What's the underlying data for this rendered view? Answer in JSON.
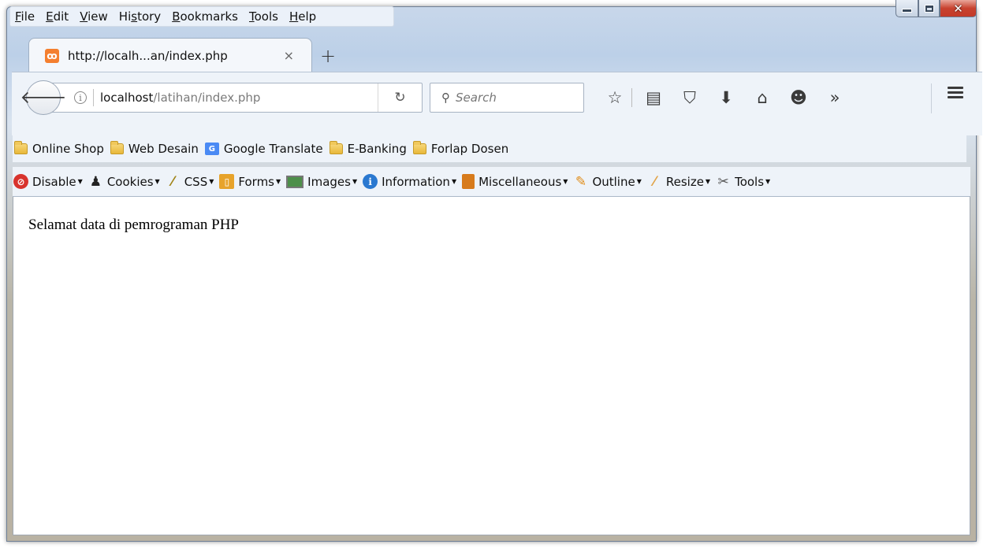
{
  "menubar": {
    "items": [
      {
        "label": "File",
        "acc": "F",
        "rest": "ile"
      },
      {
        "label": "Edit",
        "acc": "E",
        "rest": "dit"
      },
      {
        "label": "View",
        "acc": "V",
        "rest": "iew"
      },
      {
        "label": "History",
        "pre": "Hi",
        "acc": "s",
        "rest": "tory"
      },
      {
        "label": "Bookmarks",
        "acc": "B",
        "rest": "ookmarks"
      },
      {
        "label": "Tools",
        "acc": "T",
        "rest": "ools"
      },
      {
        "label": "Help",
        "acc": "H",
        "rest": "elp"
      }
    ]
  },
  "tab": {
    "title": "http://localh...an/index.php",
    "favicon": "xampp-icon",
    "close": "×"
  },
  "newtab": "+",
  "urlbar": {
    "host": "localhost",
    "path": "/latihan/index.php"
  },
  "search": {
    "placeholder": "Search"
  },
  "toolbar_icons": [
    "star-icon",
    "reading-list-icon",
    "pocket-icon",
    "download-icon",
    "home-icon",
    "hello-icon",
    "overflow-icon",
    "menu-icon"
  ],
  "bookmarks": [
    {
      "label": "Online Shop",
      "icon": "folder-icon"
    },
    {
      "label": "Web Desain",
      "icon": "folder-icon"
    },
    {
      "label": "Google Translate",
      "icon": "google-translate-icon"
    },
    {
      "label": "E-Banking",
      "icon": "folder-icon"
    },
    {
      "label": "Forlap Dosen",
      "icon": "folder-icon"
    }
  ],
  "devbar": [
    {
      "label": "Disable",
      "icon": "disable-icon"
    },
    {
      "label": "Cookies",
      "icon": "cookies-icon"
    },
    {
      "label": "CSS",
      "icon": "css-icon"
    },
    {
      "label": "Forms",
      "icon": "forms-icon"
    },
    {
      "label": "Images",
      "icon": "images-icon"
    },
    {
      "label": "Information",
      "icon": "information-icon"
    },
    {
      "label": "Miscellaneous",
      "icon": "miscellaneous-icon"
    },
    {
      "label": "Outline",
      "icon": "outline-icon"
    },
    {
      "label": "Resize",
      "icon": "resize-icon"
    },
    {
      "label": "Tools",
      "icon": "tools-icon"
    }
  ],
  "page": {
    "text": "Selamat data di pemrograman PHP"
  },
  "colors": {
    "chrome": "#eef3f9",
    "accent_close": "#c8422f",
    "favicon": "#f47f2f"
  }
}
